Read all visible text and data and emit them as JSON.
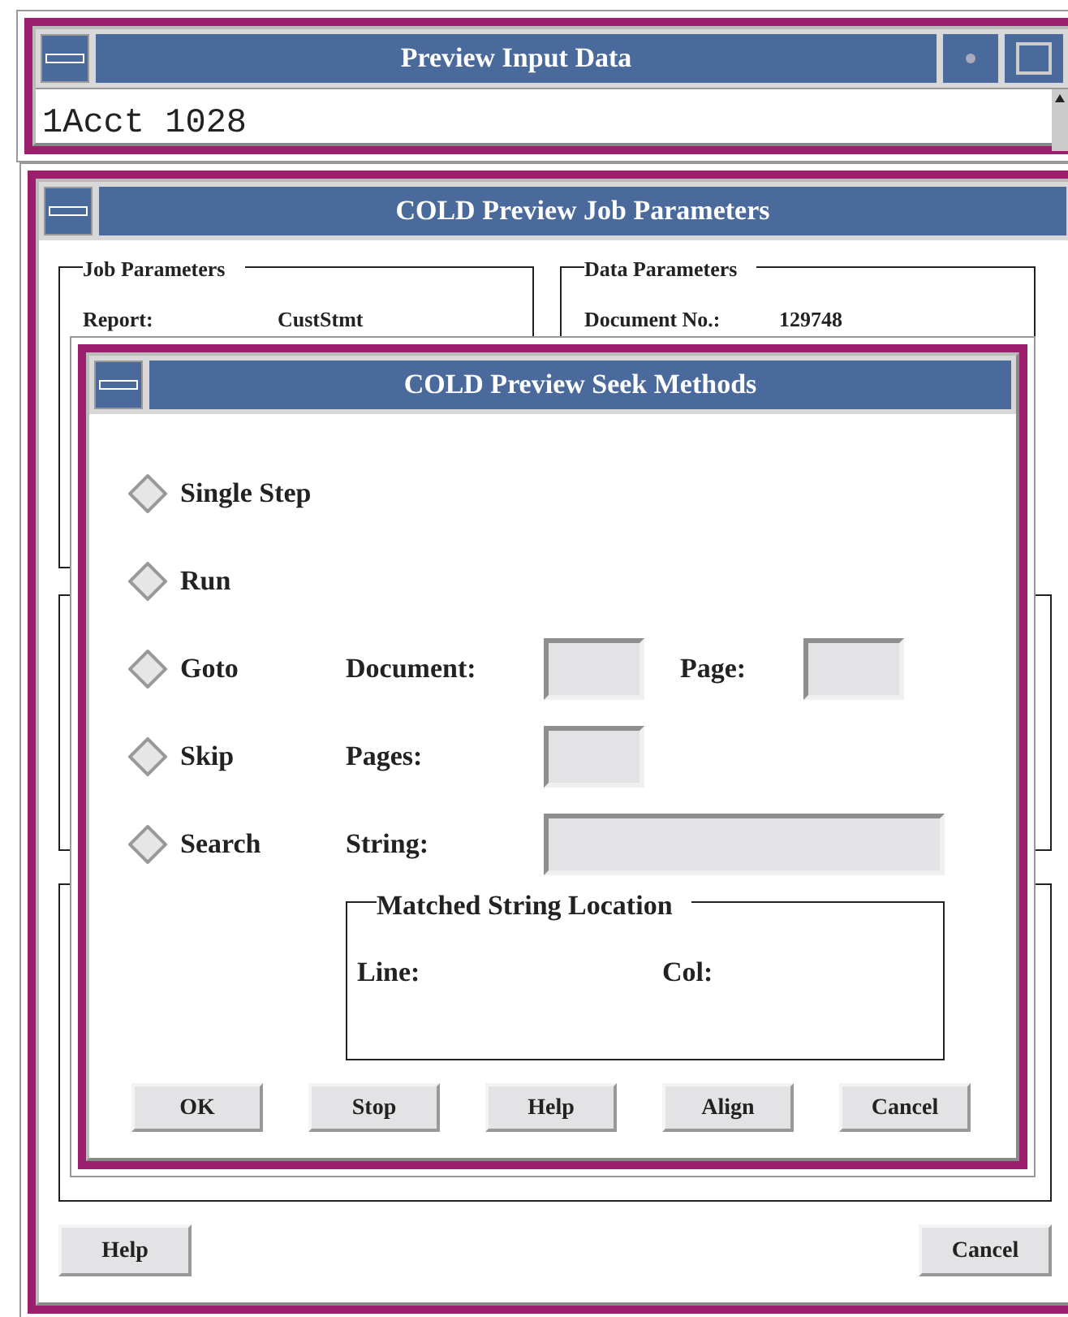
{
  "input_window": {
    "title": "Preview Input Data",
    "text": "1Acct 1028"
  },
  "job_window": {
    "title": "COLD Preview Job Parameters",
    "groups": [
      {
        "title": "Job Parameters",
        "fields": [
          {
            "label": "Report:",
            "value": "CustStmt"
          }
        ]
      },
      {
        "title": "Data Parameters",
        "fields": [
          {
            "label": "Document No.:",
            "value": "129748"
          }
        ]
      }
    ],
    "buttons": [
      "Help",
      "Cancel"
    ]
  },
  "seek_window": {
    "title": "COLD Preview Seek Methods",
    "methods": [
      {
        "label": "Single Step",
        "selected": false
      },
      {
        "label": "Run",
        "selected": false
      },
      {
        "label": "Goto",
        "selected": false,
        "fields": [
          {
            "label": "Document:",
            "kind": "short"
          },
          {
            "label": "Page:",
            "kind": "short"
          }
        ]
      },
      {
        "label": "Skip",
        "selected": false,
        "fields": [
          {
            "label": "Pages:",
            "kind": "short"
          }
        ]
      },
      {
        "label": "Search",
        "selected": false,
        "fields": [
          {
            "label": "String:",
            "kind": "long"
          }
        ]
      }
    ],
    "location": {
      "title": "Matched String Location",
      "line_label": "Line:",
      "col_label": "Col:"
    },
    "buttons": [
      "OK",
      "Stop",
      "Help",
      "Align",
      "Cancel"
    ]
  }
}
